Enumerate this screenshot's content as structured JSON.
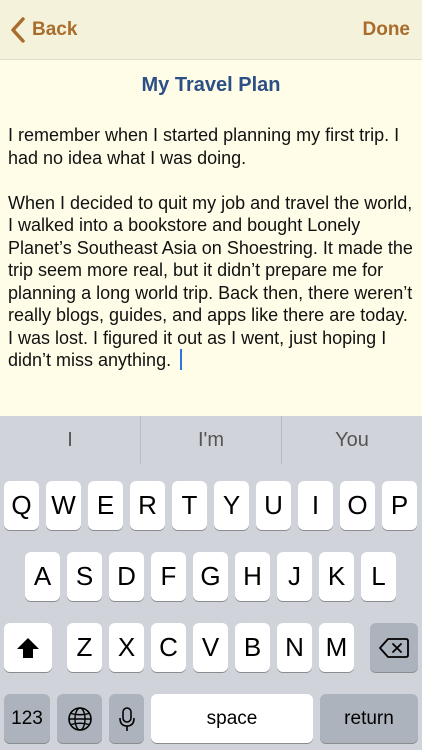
{
  "navbar": {
    "back_label": "Back",
    "done_label": "Done",
    "accent_color": "#a86d2c"
  },
  "document": {
    "title": "My Travel Plan",
    "body": "I remember when I started planning my first trip. I had no idea what I was doing.\n\nWhen I decided to quit my job and travel the world, I walked into a bookstore and bought Lonely Planet’s Southeast Asia on Shoestring. It made the trip seem more real, but it didn’t prepare me for planning a long world trip. Back then, there weren’t really blogs, guides, and apps like there are today. I was lost. I figured it out as I went, just hoping I didn’t miss anything. "
  },
  "keyboard": {
    "suggestions": [
      "I",
      "I'm",
      "You"
    ],
    "row1": [
      "Q",
      "W",
      "E",
      "R",
      "T",
      "Y",
      "U",
      "I",
      "O",
      "P"
    ],
    "row2": [
      "A",
      "S",
      "D",
      "F",
      "G",
      "H",
      "J",
      "K",
      "L"
    ],
    "row3": [
      "Z",
      "X",
      "C",
      "V",
      "B",
      "N",
      "M"
    ],
    "numbers_label": "123",
    "space_label": "space",
    "return_label": "return",
    "icons": {
      "shift": "shift-icon",
      "delete": "delete-icon",
      "globe": "globe-icon",
      "mic": "microphone-icon"
    }
  }
}
